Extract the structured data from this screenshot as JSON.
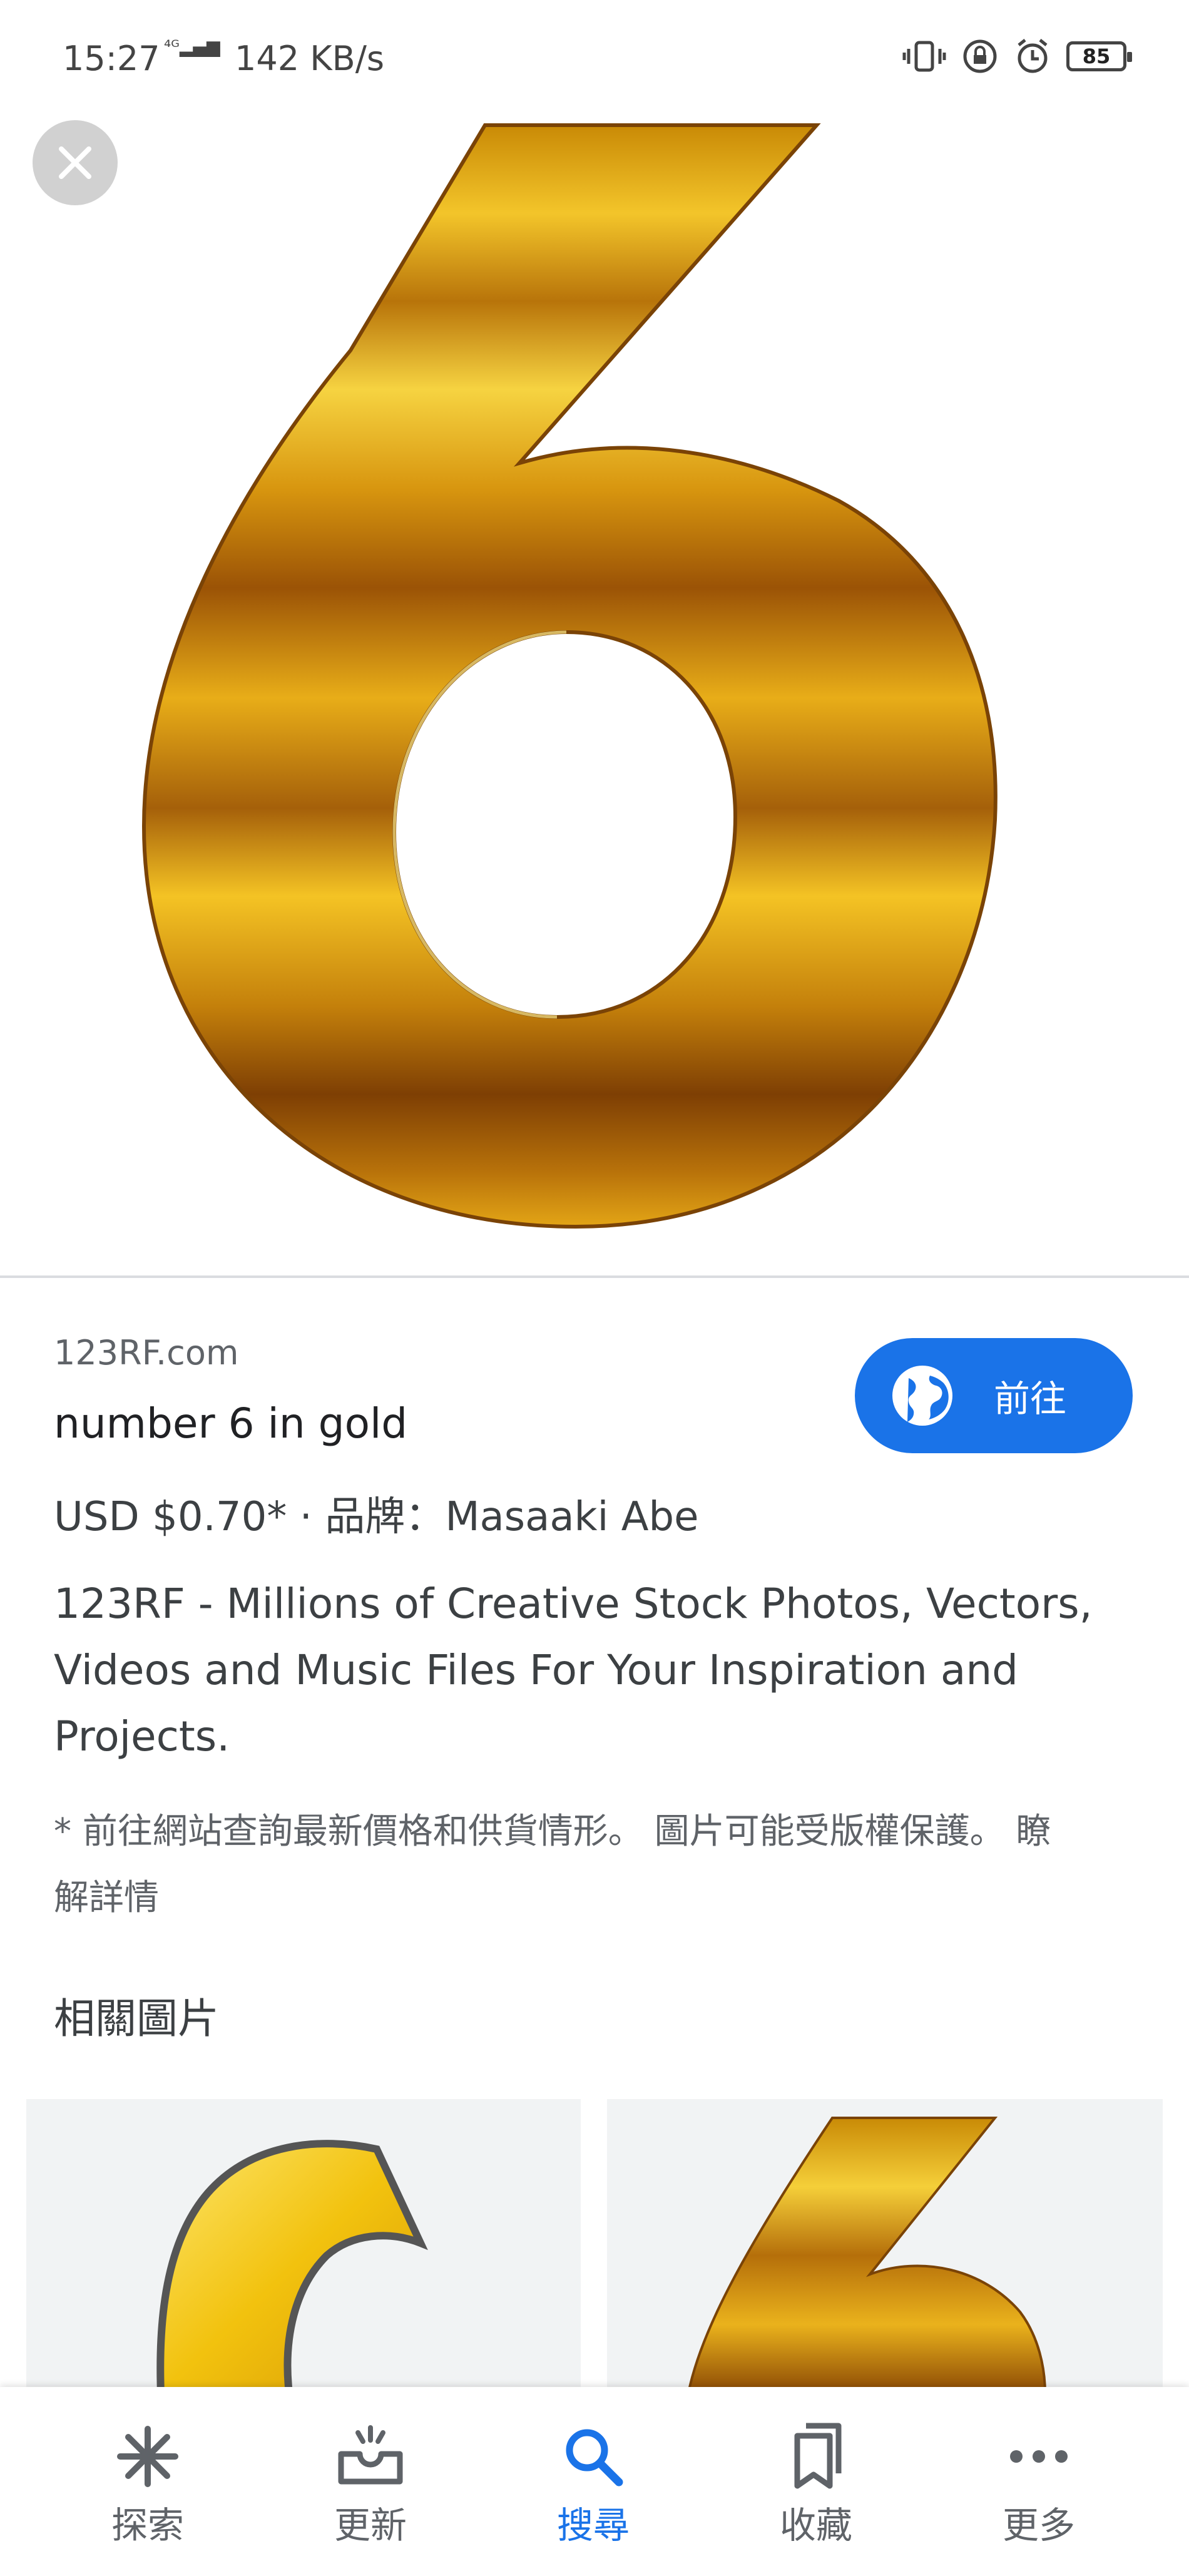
{
  "status_bar": {
    "time": "15:27",
    "network": "4G",
    "speed": "142 KB/s",
    "battery": "85"
  },
  "result": {
    "source": "123RF.com",
    "title": "number 6 in gold",
    "price": "USD $0.70* · 品牌：Masaaki Abe",
    "description": "123RF - Millions of Creative Stock Photos, Vectors, Videos and Music Files For Your Inspiration and Projects.",
    "note": "* 前往網站查詢最新價格和供貨情形。 圖片可能受版權保護。 瞭解詳情",
    "visit_label": "前往",
    "related_heading": "相關圖片"
  },
  "nav": {
    "items": [
      {
        "label": "探索",
        "icon": "asterisk-icon"
      },
      {
        "label": "更新",
        "icon": "updates-icon"
      },
      {
        "label": "搜尋",
        "icon": "search-icon",
        "active": true
      },
      {
        "label": "收藏",
        "icon": "bookmarks-icon"
      },
      {
        "label": "更多",
        "icon": "more-icon"
      }
    ]
  },
  "colors": {
    "accent": "#1a73e8",
    "gold_light": "#f7c21e",
    "gold_dark": "#7a3d05"
  }
}
